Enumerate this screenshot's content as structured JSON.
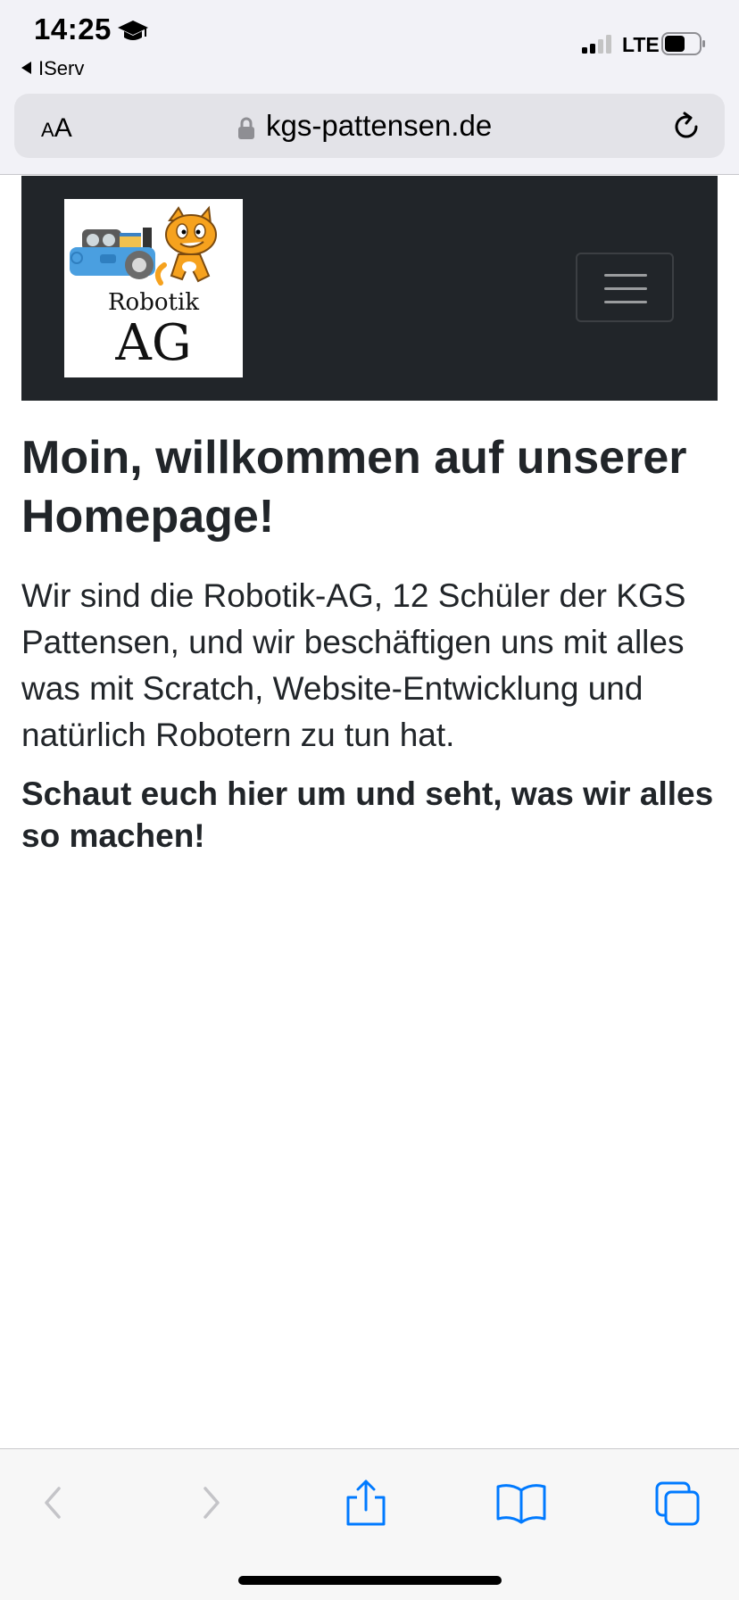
{
  "status_bar": {
    "time": "14:25",
    "back_app": "IServ",
    "network": "LTE",
    "icons": [
      "graduation-cap-icon",
      "signal-icon",
      "battery-icon"
    ]
  },
  "browser": {
    "text_size_label_small": "A",
    "text_size_label_large": "A",
    "url": "kgs-pattensen.de",
    "icons": [
      "lock-icon",
      "reload-icon",
      "back-icon",
      "forward-icon",
      "share-icon",
      "bookmarks-icon",
      "tabs-icon"
    ]
  },
  "site": {
    "logo": {
      "line1": "Robotik",
      "line2": "AG"
    },
    "heading": "Moin, willkommen auf unserer Homepage!",
    "intro": "Wir sind die Robotik-AG, 12 Schüler der KGS Pattensen, und wir beschäftigen uns mit alles was mit Scratch, Website-Entwicklung und natürlich Robotern zu tun hat.",
    "cta": "Schaut euch hier um und seht, was wir alles so machen!"
  },
  "colors": {
    "navbar_bg": "#212529",
    "text": "#212529",
    "ios_blue": "#007aff",
    "scratch_orange": "#f6a21e",
    "robot_blue": "#4a9fe0"
  }
}
